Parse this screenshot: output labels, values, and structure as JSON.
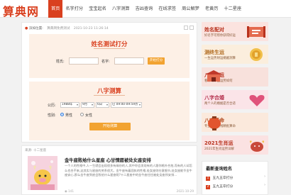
{
  "header": {
    "logo": "算典网",
    "nav": [
      "首页",
      "名字打分",
      "宝宝起名",
      "八字测算",
      "吉凶查询",
      "在线求签",
      "周公解梦",
      "老黄历",
      "十二星座"
    ]
  },
  "breadcrumb": {
    "location": "滨如位置:",
    "site": "算典网免费测试",
    "timestamp": "2021-10-23 11:26:14"
  },
  "name_test": {
    "title": "姓名测试打分",
    "surname_label": "姓氏:",
    "surname_value": "",
    "given_label": "名字:",
    "given_value": "",
    "submit": "开始打分"
  },
  "bazi_test": {
    "title": "八字测算",
    "date_label": "公历:",
    "year": "1988年",
    "month": "9月",
    "day": "6日",
    "hour": "巳 09:00-09:59点",
    "gender_label": "性别:",
    "male": "男性",
    "female": "女性",
    "submit": "开始测算"
  },
  "article": {
    "source": "来源: 十二星座",
    "title": "金牛座败给什么星座 心甘情愿被处女座安排",
    "body": "一个人的性格中,人一生就会出现很多有缘份的人,其中你会发现有的人跟你格外合拍,而有的人却怎么也合不来,这其实与星座的关系很大。金牛座有着固执的性格,处女座则在意细节,处女座能令金牛座安心,那么金牛座到底会败给什么星座呢?十二星座中的金牛座往往被处女座所安排...",
    "views": "141",
    "date": "2021-10-29"
  },
  "sidebar": {
    "banners": [
      {
        "title": "姓名配对",
        "sub": "好名字可帮你获得好运",
        "bg": "#fbe3df",
        "accent": "#d9401f"
      },
      {
        "title": "测终生运",
        "sub": "一生运势财运婚姻测算",
        "bg": "#fbeedd",
        "accent": "#c9862a"
      },
      {
        "title": "八字业运",
        "sub": "看你的事业运势如何",
        "bg": "#f8e1dc",
        "accent": "#c0392b"
      },
      {
        "title": "八字合婚",
        "sub": "两个人的婚姻是否合适",
        "bg": "#fbe4e8",
        "accent": "#d04a6a"
      },
      {
        "title": "八字算命",
        "sub": "专业八字在线精批算命",
        "bg": "#fbe9dc",
        "accent": "#c95a2a"
      },
      {
        "title": "2021生肖运",
        "sub": "2021年生肖运势详解",
        "bg": "#fbe2e2",
        "accent": "#c43b3b"
      }
    ],
    "list_title": "最新查询姓名",
    "list": [
      {
        "num": "1",
        "text": "五九五卒打分"
      },
      {
        "num": "2",
        "text": "五九五卒打分"
      }
    ]
  }
}
